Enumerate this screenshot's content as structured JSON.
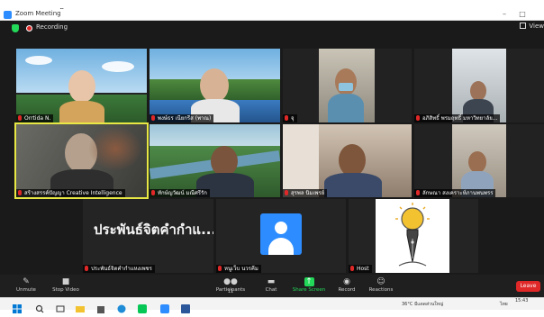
{
  "window": {
    "title": "Zoom Meeting",
    "minimize": "–",
    "maximize": "□"
  },
  "status": {
    "recording_label": "Recording",
    "view_label": "View"
  },
  "participants": [
    {
      "name": "Orrtida N."
    },
    {
      "name": "พงษ์ธร เนียกรีส (พาณ)"
    },
    {
      "name": "จุ"
    },
    {
      "name": "อภิสิทธิ์ พรมฤทธิ์ มหาวิทยาลัย..."
    },
    {
      "name": "สร้างสรรค์ปัญญา Creative Intelligence"
    },
    {
      "name": "ทักษ์ญวัฒน์ มณีศรีรัก"
    },
    {
      "name": "สุรพล นิมเพรย์"
    },
    {
      "name": "ลักษณา สงเคราะห์ภานพนพรร"
    },
    {
      "name": "ประพันธ์จิตคำกำแหงเพชร",
      "slide_text": "ประพันธ์จิตคำกำแ..."
    },
    {
      "name": "หนูเว็บ นวรคีม"
    },
    {
      "name": "Host"
    }
  ],
  "toolbar": {
    "unmute": "Unmute",
    "stop_video": "Stop Video",
    "participants": "Participants",
    "participants_count": "11",
    "chat": "Chat",
    "share_screen": "Share Screen",
    "record": "Record",
    "reactions": "Reactions",
    "leave": "Leave"
  },
  "taskbar": {
    "weather": "36°C มีแดดส่วนใหญ่",
    "lang": "ไทย",
    "time": "15:43"
  },
  "colors": {
    "accent_blue": "#2d8cff",
    "share_green": "#23d959",
    "leave_red": "#e02828",
    "active_speaker": "#e8e845"
  }
}
